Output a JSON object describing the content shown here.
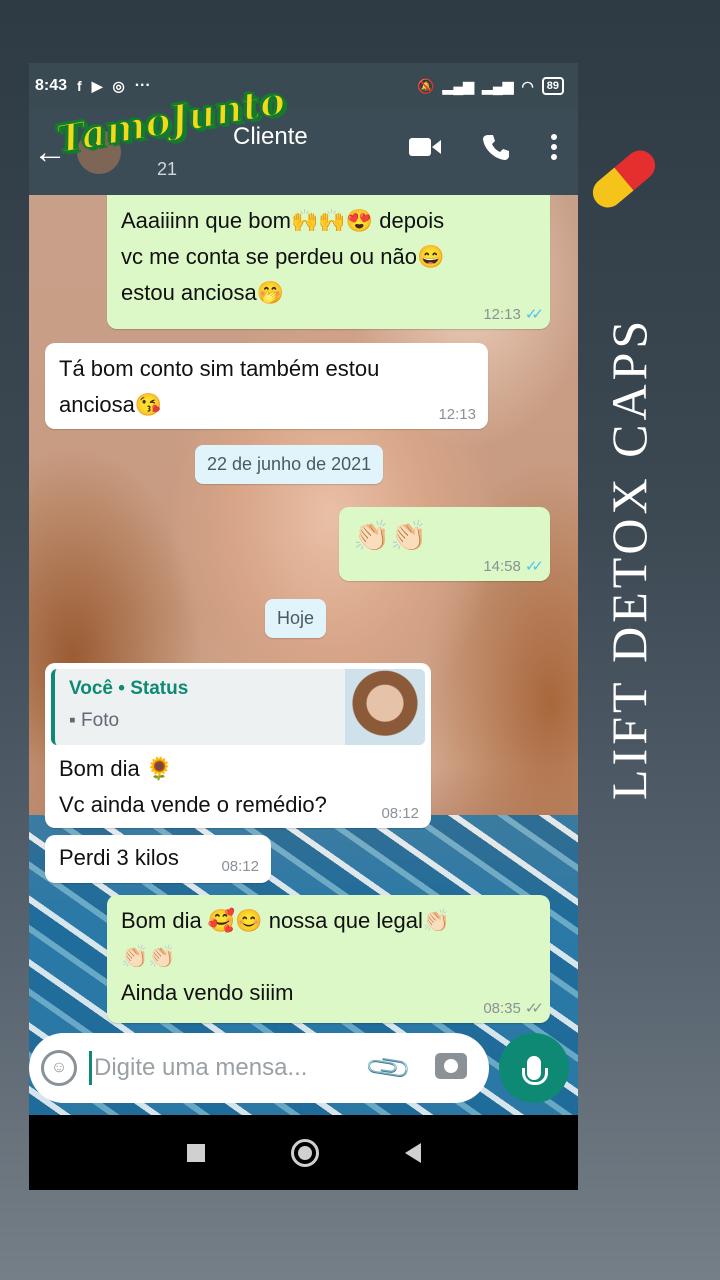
{
  "status_bar": {
    "time": "8:43",
    "more": "···",
    "battery": "89",
    "icons": [
      "facebook-icon",
      "youtube-icon",
      "instagram-icon",
      "mute-icon",
      "signal-icon",
      "signal-icon",
      "wifi-icon",
      "battery-icon"
    ]
  },
  "header": {
    "contact_name": "Cliente",
    "contact_sub": "21"
  },
  "sticker": {
    "text": "TamoJunto"
  },
  "side_banner": {
    "text": "LIFT DETOX CAPS"
  },
  "messages": [
    {
      "dir": "out",
      "line1": "Aaaiiinn que bom🙌🙌😍 depois",
      "line2": "vc me conta se perdeu ou não😄",
      "line3": "estou anciosa🤭",
      "time": "12:13",
      "ticks": "✓✓"
    },
    {
      "dir": "in",
      "line1": "Tá bom conto sim também estou",
      "line2": "anciosa😘",
      "time": "12:13"
    },
    {
      "dir": "date",
      "text": "22 de junho de 2021"
    },
    {
      "dir": "out",
      "line1": "👏🏻👏🏻",
      "time": "14:58",
      "ticks": "✓✓"
    },
    {
      "dir": "date",
      "text": "Hoje"
    },
    {
      "dir": "in",
      "quote_title": "Você • Status",
      "quote_sub": "Foto",
      "line1": "Bom dia 🌻",
      "line2": "Vc ainda vende o remédio?",
      "time": "08:12"
    },
    {
      "dir": "in",
      "line1": "Perdi 3 kilos",
      "time": "08:12"
    },
    {
      "dir": "out",
      "line1": "Bom dia 🥰😊 nossa que legal👏🏻",
      "line2": "👏🏻👏🏻",
      "line3": "Ainda vendo siiim",
      "time": "08:35",
      "ticks": "✓✓"
    }
  ],
  "composer": {
    "placeholder": "Digite uma mensa..."
  },
  "colors": {
    "accent": "#0e8a74",
    "out_bubble": "#dcf8c6",
    "in_bubble": "#ffffff",
    "appbar": "#3b4c56",
    "read_ticks": "#4fc3f7"
  }
}
